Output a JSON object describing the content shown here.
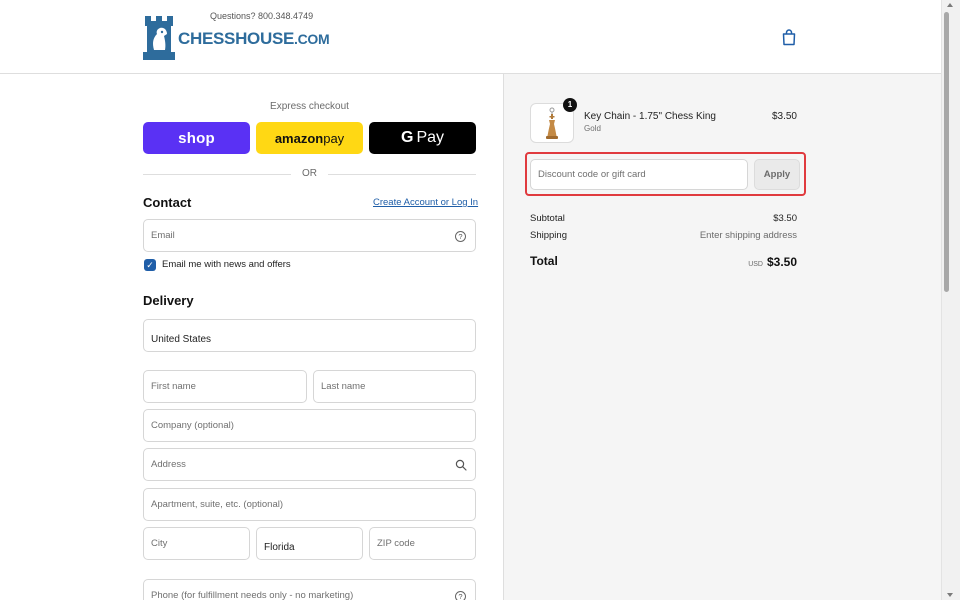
{
  "header": {
    "brand_name": "CHESSHOUSE",
    "brand_suffix": ".COM",
    "questions": "Questions? 800.348.4749",
    "icons": {
      "logo": "rook-knight-logo",
      "cart": "shopping-bag-icon"
    }
  },
  "express": {
    "label": "Express checkout",
    "shop_label": "shop",
    "amazon_label_bold": "amazon",
    "amazon_label": " pay",
    "gpay_g": "G",
    "gpay_label": "Pay",
    "or": "OR"
  },
  "contact": {
    "title": "Contact",
    "login_link": "Create Account or Log In",
    "email_placeholder": "Email",
    "news_checked": true,
    "news_label": "Email me with news and offers"
  },
  "delivery": {
    "title": "Delivery",
    "country": "United States",
    "first_name_placeholder": "First name",
    "last_name_placeholder": "Last name",
    "company_placeholder": "Company (optional)",
    "address_placeholder": "Address",
    "apartment_placeholder": "Apartment, suite, etc. (optional)",
    "city_placeholder": "City",
    "state": "Florida",
    "zip_placeholder": "ZIP code",
    "phone_placeholder": "Phone (for fulfillment needs only - no marketing)"
  },
  "order": {
    "quantity": "1",
    "product_name": "Key Chain - 1.75\" Chess King",
    "variant": "Gold",
    "price": "$3.50",
    "discount_placeholder": "Discount code or gift card",
    "apply_label": "Apply",
    "subtotal_label": "Subtotal",
    "subtotal_value": "$3.50",
    "shipping_label": "Shipping",
    "shipping_value": "Enter shipping address",
    "total_label": "Total",
    "total_currency": "USD",
    "total_value": "$3.50"
  },
  "colors": {
    "brand_blue": "#2e6c9c",
    "shop_purple": "#5a31f4",
    "amazon_yellow": "#ffd814",
    "link_blue": "#1f5ea8",
    "highlight_red": "#e03a3e"
  }
}
